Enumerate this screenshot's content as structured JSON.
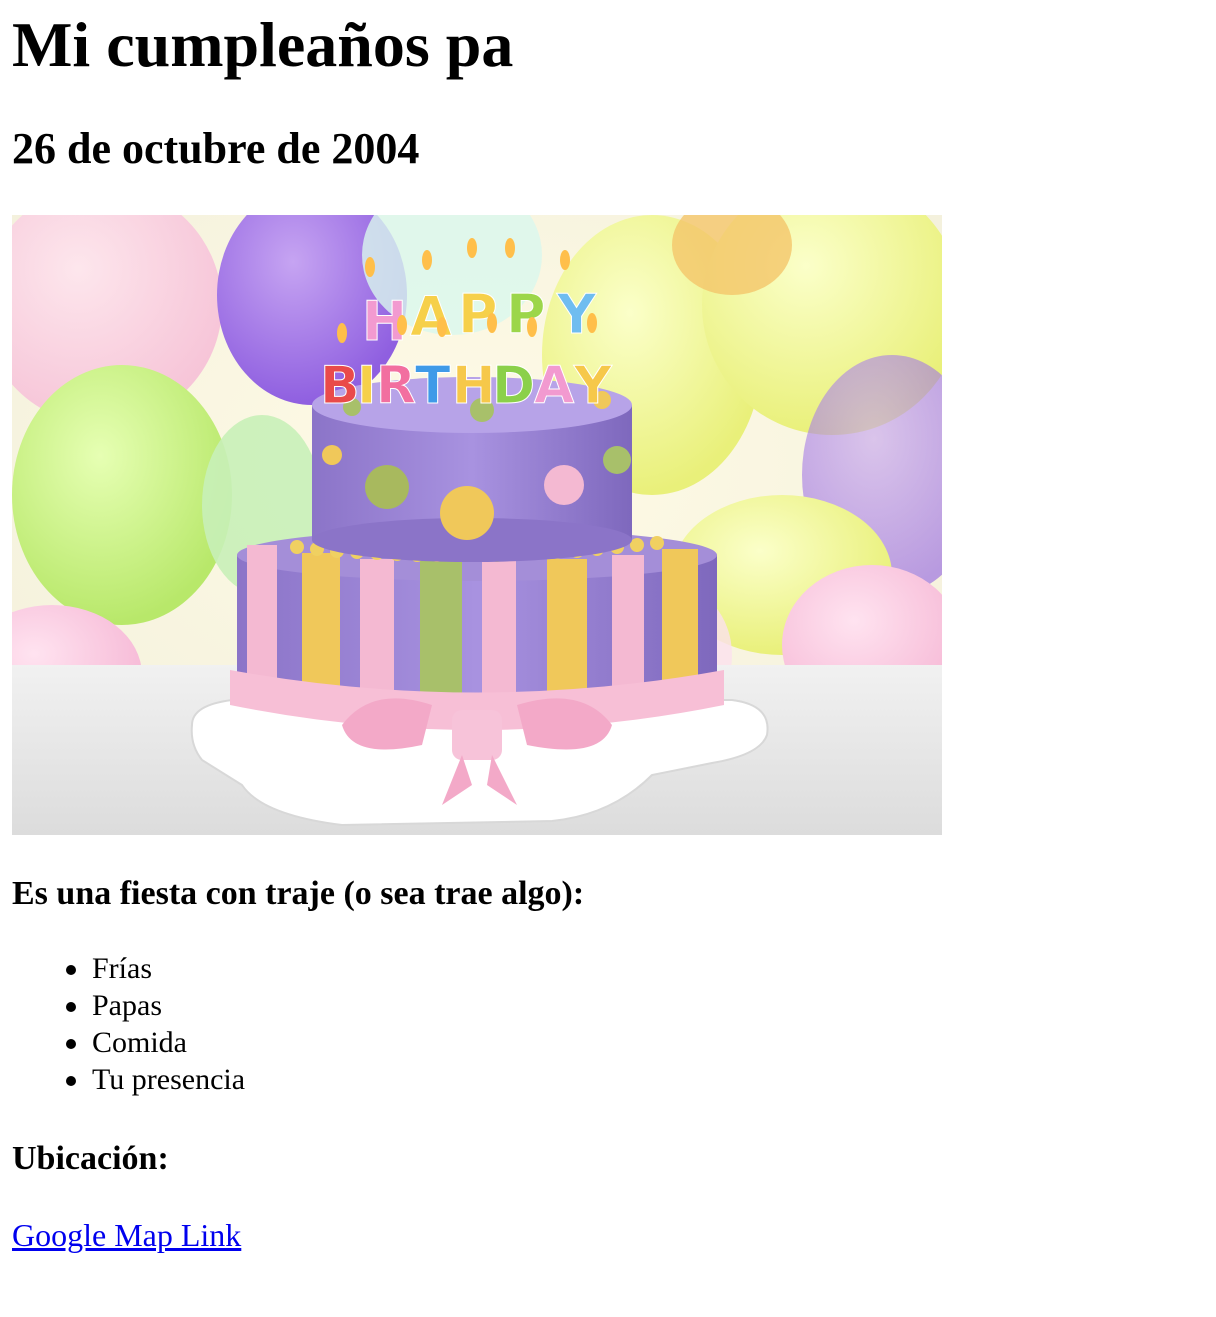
{
  "header": {
    "title": "Mi cumpleaños pa",
    "date": "26 de octubre de 2004"
  },
  "hero": {
    "image": "birthday-cake",
    "candles_text": "HAPPY BIRTHDAY"
  },
  "bring_section": {
    "heading": "Es una fiesta con traje (o sea trae algo):",
    "items": [
      "Frías",
      "Papas",
      "Comida",
      "Tu presencia"
    ]
  },
  "location_section": {
    "heading": "Ubicación:",
    "link_text": "Google Map Link"
  },
  "colors": {
    "link": "#0000ee",
    "cake_purple": "#9b86d6",
    "cake_pink": "#f4b9d2",
    "cake_yellow": "#f0c85a",
    "cake_green": "#a8c06a"
  }
}
